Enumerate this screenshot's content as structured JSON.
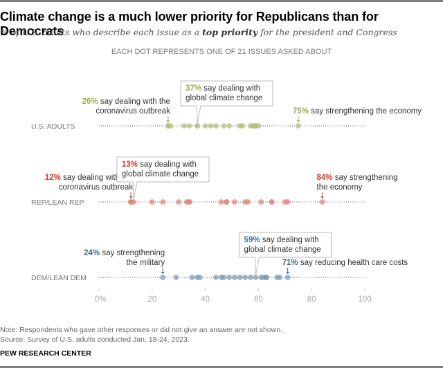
{
  "title": "Climate change is a much lower priority for Republicans than for Democrats",
  "subtitle_pre": "% of U.S. adults who describe each issue as a ",
  "subtitle_bold": "top priority",
  "subtitle_post": " for the president and Congress",
  "caption": "EACH DOT REPRESENTS ONE OF 21 ISSUES ASKED ABOUT",
  "note": "Note: Respondents who gave other responses or did not give an answer are not shown.",
  "source": "Source: Survey of U.S. adults conducted Jan. 18-24, 2023.",
  "brand": "PEW RESEARCH CENTER",
  "chart_data": {
    "type": "scatter",
    "title": "Climate change is a much lower priority for Republicans than for Democrats",
    "xlabel": "",
    "xlim": [
      0,
      100
    ],
    "xticks": [
      "0%",
      "20",
      "40",
      "60",
      "80",
      "100"
    ],
    "xtick_values": [
      0,
      20,
      40,
      60,
      80,
      100
    ],
    "grid": false,
    "series": [
      {
        "name": "U.S. ADULTS",
        "color": "#9aab54",
        "dot_color": "#b5c27e",
        "values": [
          26,
          26,
          27,
          32,
          34,
          37,
          37,
          40,
          42,
          44,
          47,
          49,
          53,
          54,
          57,
          58,
          58,
          59,
          59,
          60,
          75
        ],
        "annotations": [
          {
            "value": 26,
            "pct": "26%",
            "lines": [
              "say dealing with the",
              "coronavirus outbreak"
            ],
            "style": "arrow-left"
          },
          {
            "value": 37,
            "pct": "37%",
            "lines": [
              "say dealing with",
              "global climate change"
            ],
            "style": "callout"
          },
          {
            "value": 75,
            "pct": "75%",
            "lines": [
              "say strengthening the economy"
            ],
            "style": "arrow-right"
          }
        ]
      },
      {
        "name": "REP/LEAN REP",
        "color": "#d03e2d",
        "dot_color": "#e08a7e",
        "values": [
          12,
          12,
          13,
          20,
          24,
          30,
          33,
          34,
          34,
          46,
          48,
          48,
          51,
          55,
          56,
          61,
          65,
          65,
          70,
          71,
          84
        ],
        "annotations": [
          {
            "value": 12,
            "pct": "12%",
            "lines": [
              "say dealing with the",
              "coronavirus outbreak"
            ],
            "style": "arrow-left"
          },
          {
            "value": 13,
            "pct": "13%",
            "lines": [
              "say dealing with",
              "global climate change"
            ],
            "style": "callout"
          },
          {
            "value": 84,
            "pct": "84%",
            "lines": [
              "say strengthening",
              "the economy"
            ],
            "style": "arrow-right"
          }
        ]
      },
      {
        "name": "DEM/LEAN DEM",
        "color": "#3d6a8c",
        "dot_color": "#7d9db6",
        "values": [
          24,
          29,
          35,
          37,
          38,
          44,
          46,
          47,
          49,
          51,
          53,
          55,
          57,
          59,
          61,
          62,
          63,
          63,
          67,
          68,
          71
        ],
        "annotations": [
          {
            "value": 24,
            "pct": "24%",
            "lines": [
              "say strengthening",
              "the military"
            ],
            "style": "arrow-left"
          },
          {
            "value": 59,
            "pct": "59%",
            "lines": [
              "say dealing with",
              "global climate change"
            ],
            "style": "callout"
          },
          {
            "value": 71,
            "pct": "71%",
            "lines": [
              "say reducing health care costs"
            ],
            "style": "arrow-right"
          }
        ]
      }
    ]
  }
}
